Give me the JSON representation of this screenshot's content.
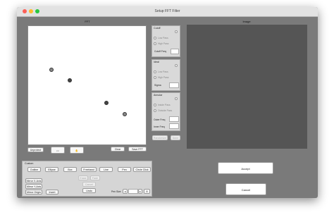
{
  "window": {
    "title": "Setup FFT Filter"
  },
  "fft_panel": {
    "label": "FFT"
  },
  "image_panel": {
    "label": "Image"
  },
  "fft_controls": {
    "unprotect": "Unprotect",
    "clear": "Clear",
    "save_fft": "Save FFT"
  },
  "cutoff_group": {
    "title": "Cutoff",
    "low_pass": "Low Pass",
    "high_pass": "High Pass",
    "freq_label": "Cutoff Freq"
  },
  "ideal_group": {
    "title": "Ideal",
    "low_pass": "Low Pass",
    "high_pass": "High Pass",
    "sigma_label": "Sigma"
  },
  "annular_group": {
    "title": "Annular",
    "inside_pass": "Inside Pass",
    "outside_pass": "Outside Pass",
    "outer_freq": "Outer Freq",
    "inner_freq": "Inner Freq"
  },
  "side_buttons": {
    "randomize": "Randomize",
    "done": "Done"
  },
  "custom": {
    "title": "Custom",
    "shapes": [
      "Outline",
      "Ellipse",
      "Box",
      "Freehand",
      "Line",
      "Pen",
      "Circle Click"
    ],
    "mirror_x": "Mirror X-Axis",
    "mirror_y": "Mirror Y-Axis",
    "mirror_origin": "Mirror Origin",
    "invert": "Invert",
    "erase": "Erase",
    "fade": "Fade",
    "cancel": "Cancel",
    "undo": "Undo",
    "pen_size_label": "Pen Size",
    "pen_size_value": "8"
  },
  "dialog": {
    "accept": "Accept",
    "cancel": "Cancel"
  }
}
